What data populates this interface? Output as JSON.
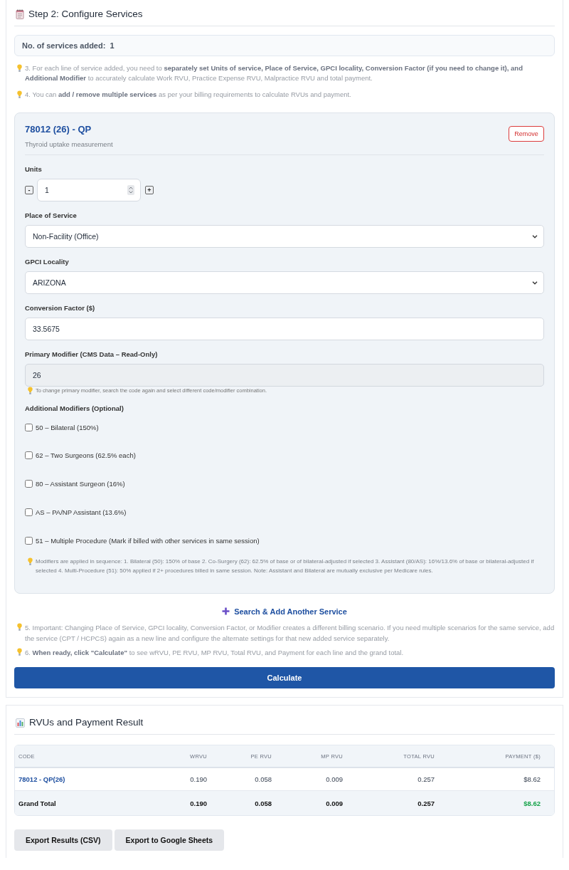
{
  "configure_section": {
    "title": "Step 2: Configure Services",
    "services_count": {
      "label": "No. of services added:",
      "value": "1"
    },
    "instructions": [
      "3. For each line of service added, you need to **separately set Units of service, Place of Service, GPCI locality, Conversion Factor (if you need to change it), and Additional Modifier** to accurately calculate Work RVU, Practice Expense RVU, Malpractice RVU and total payment.",
      "4. You can **add / remove multiple services** as per your billing requirements to calculate RVUs and payment."
    ],
    "services": [
      {
        "title": "78012 (26) - QP",
        "description": "Thyroid uptake measurement",
        "remove_button": "Remove",
        "units": {
          "label": "Units",
          "value": "1",
          "decrement": "-",
          "increment": "+"
        },
        "place_of_service": {
          "label": "Place of Service",
          "value": "Non-Facility (Office)"
        },
        "gpci_locality": {
          "label": "GPCI Locality",
          "value": "ARIZONA"
        },
        "conversion_factor": {
          "label": "Conversion Factor ($)",
          "value": "33.5675"
        },
        "primary_modifier": {
          "label": "Primary Modifier (CMS Data – Read-Only)",
          "value": "26",
          "read_only": true,
          "hint": "To change primary modifier, search the code again and select different code/modifier combination."
        },
        "additional_modifiers": {
          "label": "Additional Modifiers (Optional)",
          "options": [
            {
              "label": "50 – Bilateral (150%)",
              "checked": false
            },
            {
              "label": "62 – Two Surgeons (62.5% each)",
              "checked": false
            },
            {
              "label": "80 – Assistant Surgeon (16%)",
              "checked": false
            },
            {
              "label": "AS – PA/NP Assistant (13.6%)",
              "checked": false
            },
            {
              "label": "51 – Multiple Procedure (Mark if billed with other services in same session)",
              "checked": false
            }
          ],
          "note": "Modifiers are applied in sequence: 1. Bilateral (50): 150% of base 2. Co-Surgery (62): 62.5% of base or of bilateral-adjusted if selected 3. Assistant (80/AS): 16%/13.6% of base or bilateral-adjusted if selected 4. Multi-Procedure (51): 50% applied if 2+ procedures billed in same session. Note: Assistant and Bilateral are mutually exclusive per Medicare rules."
        }
      }
    ],
    "add_service_link": "Search & Add Another Service",
    "notes": [
      "5. Important: Changing Place of Service, GPCI locality, Conversion Factor, or Modifier creates a different billing scenario. If you need multiple scenarios for the same service, add the service (CPT / HCPCS) again as a new line and configure the alternate settings for that new added service separately.",
      "6. **When ready, click \"Calculate\"** to see wRVU, PE RVU, MP RVU, Total RVU, and Payment for each line and the grand total."
    ],
    "calculate_button": "Calculate"
  },
  "results_section": {
    "title": "RVUs and Payment Result",
    "table": {
      "columns": [
        "CODE",
        "WRVU",
        "PE RVU",
        "MP RVU",
        "TOTAL RVU",
        "PAYMENT ($)"
      ],
      "rows": [
        {
          "kind": "line",
          "cells": [
            "78012 - QP(26)",
            "0.190",
            "0.058",
            "0.009",
            "0.257",
            "$8.62"
          ]
        },
        {
          "kind": "total",
          "cells": [
            "Grand Total",
            "0.190",
            "0.058",
            "0.009",
            "0.257",
            "$8.62"
          ]
        }
      ]
    },
    "export_buttons": [
      "Export Results (CSV)",
      "Export to Google Sheets"
    ]
  }
}
